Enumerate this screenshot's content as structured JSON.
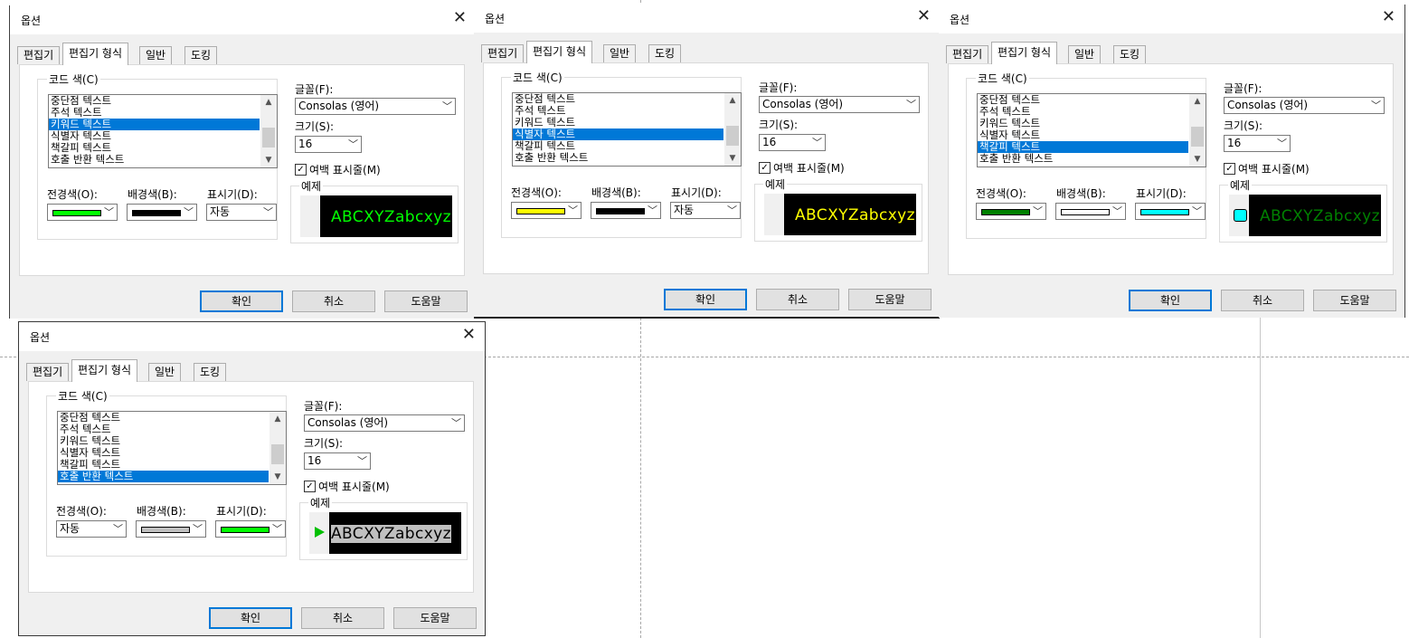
{
  "colors": {
    "accent": "#0078d7",
    "black": "#000000"
  },
  "dialogs": [
    {
      "title": "옵션",
      "close_icon": "close-icon",
      "tabs": [
        "편집기",
        "편집기 형식",
        "일반",
        "도킹"
      ],
      "active_tab": 1,
      "code_colors_label": "코드 색(C)",
      "items": [
        "중단점 텍스트",
        "주석 텍스트",
        "키워드 텍스트",
        "식별자 텍스트",
        "책갈피 텍스트",
        "호출 반환 텍스트"
      ],
      "selected_index": 2,
      "foreground_label": "전경색(O):",
      "background_label": "배경색(B):",
      "indicator_label": "표시기(D):",
      "foreground_color": "#00ff00",
      "background_color": "#000000",
      "indicator_value": "자동",
      "font_label": "글꼴(F):",
      "font_value": "Consolas (영어)",
      "size_label": "크기(S):",
      "size_value": "16",
      "margin_checkbox_label": "여백 표시줄(M)",
      "margin_checked": true,
      "sample_label": "예제",
      "sample_text": "ABCXYZabcxyz",
      "sample_color": "#00ff00",
      "ok_label": "확인",
      "cancel_label": "취소",
      "help_label": "도움말"
    },
    {
      "title": "옵션",
      "close_icon": "close-icon",
      "tabs": [
        "편집기",
        "편집기 형식",
        "일반",
        "도킹"
      ],
      "active_tab": 1,
      "code_colors_label": "코드 색(C)",
      "items": [
        "중단점 텍스트",
        "주석 텍스트",
        "키워드 텍스트",
        "식별자 텍스트",
        "책갈피 텍스트",
        "호출 반환 텍스트"
      ],
      "selected_index": 3,
      "foreground_label": "전경색(O):",
      "background_label": "배경색(B):",
      "indicator_label": "표시기(D):",
      "foreground_color": "#ffff00",
      "background_color": "#000000",
      "indicator_value": "자동",
      "font_label": "글꼴(F):",
      "font_value": "Consolas (영어)",
      "size_label": "크기(S):",
      "size_value": "16",
      "margin_checkbox_label": "여백 표시줄(M)",
      "margin_checked": true,
      "sample_label": "예제",
      "sample_text": "ABCXYZabcxyz",
      "sample_color": "#ffff00",
      "ok_label": "확인",
      "cancel_label": "취소",
      "help_label": "도움말"
    },
    {
      "title": "옵션",
      "close_icon": "close-icon",
      "tabs": [
        "편집기",
        "편집기 형식",
        "일반",
        "도킹"
      ],
      "active_tab": 1,
      "code_colors_label": "코드 색(C)",
      "items": [
        "중단점 텍스트",
        "주석 텍스트",
        "키워드 텍스트",
        "식별자 텍스트",
        "책갈피 텍스트",
        "호출 반환 텍스트"
      ],
      "selected_index": 4,
      "foreground_label": "전경색(O):",
      "background_label": "배경색(B):",
      "indicator_label": "표시기(D):",
      "foreground_color": "#008000",
      "background_color": "#ffffff",
      "indicator_color": "#00ffff",
      "font_label": "글꼴(F):",
      "font_value": "Consolas (영어)",
      "size_label": "크기(S):",
      "size_value": "16",
      "margin_checkbox_label": "여백 표시줄(M)",
      "margin_checked": true,
      "sample_label": "예제",
      "sample_text": "ABCXYZabcxyz",
      "sample_color": "#008000",
      "sample_marker": "bookmark-marker-icon",
      "ok_label": "확인",
      "cancel_label": "취소",
      "help_label": "도움말"
    },
    {
      "title": "옵션",
      "close_icon": "close-icon",
      "tabs": [
        "편집기",
        "편집기 형식",
        "일반",
        "도킹"
      ],
      "active_tab": 1,
      "code_colors_label": "코드 색(C)",
      "items": [
        "중단점 텍스트",
        "주석 텍스트",
        "키워드 텍스트",
        "식별자 텍스트",
        "책갈피 텍스트",
        "호출 반환 텍스트"
      ],
      "selected_index": 5,
      "foreground_label": "전경색(O):",
      "background_label": "배경색(B):",
      "indicator_label": "표시기(D):",
      "foreground_value": "자동",
      "background_color": "#c0c0c0",
      "indicator_color": "#00ff00",
      "font_label": "글꼴(F):",
      "font_value": "Consolas (영어)",
      "size_label": "크기(S):",
      "size_value": "16",
      "margin_checkbox_label": "여백 표시줄(M)",
      "margin_checked": true,
      "sample_label": "예제",
      "sample_text": "ABCXYZabcxyz",
      "sample_color": "#000000",
      "sample_highlight": "#c0c0c0",
      "sample_marker": "call-return-arrow-icon",
      "ok_label": "확인",
      "cancel_label": "취소",
      "help_label": "도움말"
    }
  ]
}
